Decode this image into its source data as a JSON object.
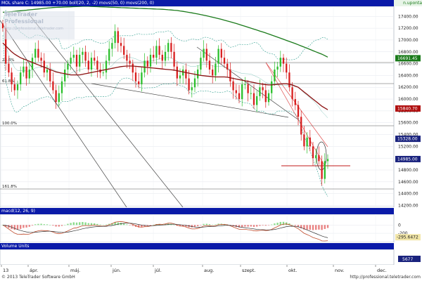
{
  "header": {
    "main": "MOL share C: 14985.00 +70.00 boll(20, 2, -2) movs(50, 0) movs(200, 0)",
    "main_right": "n.uponta",
    "macd": "macd(12, 26, 9)",
    "volume": "Volume Units"
  },
  "watermark": {
    "line1": "TeleTrader Professional",
    "line2": "http://professional.teletrader.com"
  },
  "footer": {
    "left": "© 2013 TeleTrader Software GmbH",
    "right": "http://professional.teletrader.com"
  },
  "fib_labels": [
    "23.6%",
    "61.8%",
    "100.0%",
    "161.8%"
  ],
  "colors": {
    "header_bg": "#0a1aa8",
    "up": "#2bbf2b",
    "down": "#d81e1e",
    "ma50": "#8b1010",
    "ma200": "#1a7a1a",
    "boll": "#2e9e8e",
    "marker_bg": "#1a237e"
  },
  "chart_data": {
    "type": "candlestick",
    "price_axis": {
      "ticks": [
        14200,
        14400,
        14600,
        14800,
        15000,
        15200,
        15400,
        15600,
        15800,
        16000,
        16200,
        16400,
        16600,
        16800,
        17000,
        17200,
        17400
      ],
      "ylim": [
        14170,
        17570
      ]
    },
    "markers": [
      {
        "label": "16691.45",
        "value": 16691.45
      },
      {
        "label": "15840.70",
        "value": 15840.7
      },
      {
        "label": "15328.00",
        "value": 15328.0
      },
      {
        "label": "14985.00",
        "value": 14985.0
      }
    ],
    "x_ticks": [
      "13",
      "ápr.",
      "máj.",
      "jún.",
      "júl.",
      "aug.",
      "szept.",
      "okt.",
      "nov.",
      "dec."
    ],
    "macd_axis": {
      "ticks": [
        0,
        -200
      ],
      "marker": "-295.6472"
    },
    "volume_marker": "5677",
    "close": [
      17200,
      16600,
      16450,
      16250,
      16150,
      16250,
      16450,
      16550,
      16350,
      16500,
      16700,
      16850,
      16700,
      16650,
      16450,
      16500,
      16300,
      16150,
      15950,
      16100,
      16300,
      16500,
      16600,
      16700,
      16750,
      16550,
      16750,
      16800,
      16650,
      16500,
      16700,
      16650,
      16500,
      16450,
      16450,
      16650,
      16850,
      16950,
      17150,
      16950,
      16900,
      16750,
      16650,
      16600,
      16450,
      16300,
      16250,
      16450,
      16650,
      16550,
      16750,
      16700,
      16900,
      16750,
      16650,
      16800,
      16950,
      16800,
      16550,
      16350,
      16400,
      16500,
      16350,
      16150,
      16200,
      16350,
      16500,
      16700,
      16850,
      16650,
      16500,
      16400,
      16600,
      16850,
      16700,
      16600,
      16500,
      16300,
      16150,
      16100,
      16000,
      16250,
      16250,
      16100,
      16100,
      15900,
      16050,
      16200,
      16150,
      15950,
      16100,
      16300,
      16500,
      16550,
      16700,
      16600,
      16450,
      16200,
      16000,
      15900,
      15700,
      15400,
      15200,
      15350,
      15200,
      15000,
      15050,
      14950,
      14650,
      14950,
      14985
    ],
    "ma50": [
      16950,
      16900,
      16850,
      16800,
      16760,
      16730,
      16700,
      16680,
      16660,
      16640,
      16620,
      16600,
      16580,
      16560,
      16540,
      16520,
      16500,
      16480,
      16460,
      16450,
      16440,
      16430,
      16420,
      16410,
      16410,
      16410,
      16410,
      16420,
      16430,
      16440,
      16450,
      16460,
      16470,
      16480,
      16490,
      16500,
      16510,
      16520,
      16530,
      16540,
      16550,
      16555,
      16560,
      16560,
      16560,
      16555,
      16550,
      16545,
      16540,
      16535,
      16530,
      16525,
      16520,
      16515,
      16510,
      16505,
      16500,
      16495,
      16490,
      16480,
      16470,
      16460,
      16450,
      16440,
      16430,
      16420,
      16410,
      16400,
      16395,
      16390,
      16385,
      16380,
      16375,
      16375,
      16375,
      16375,
      16370,
      16360,
      16350,
      16340,
      16330,
      16320,
      16310,
      16300,
      16290,
      16280,
      16270,
      16260,
      16250,
      16245,
      16240,
      16240,
      16245,
      16250,
      16255,
      16260,
      16260,
      16250,
      16240,
      16220,
      16200,
      16160,
      16120,
      16080,
      16040,
      16000,
      15960,
      15920,
      15880,
      15850,
      15820
    ],
    "ma200": [
      17470,
      17470,
      17475,
      17480,
      17485,
      17490,
      17495,
      17500,
      17505,
      17510,
      17515,
      17520,
      17525,
      17530,
      17535,
      17540,
      17545,
      17550,
      17552,
      17554,
      17556,
      17558,
      17560,
      17562,
      17564,
      17566,
      17568,
      17570,
      17570,
      17570,
      17568,
      17566,
      17564,
      17562,
      17560,
      17558,
      17556,
      17554,
      17552,
      17550,
      17548,
      17546,
      17544,
      17542,
      17540,
      17538,
      17536,
      17534,
      17532,
      17530,
      17528,
      17526,
      17524,
      17522,
      17520,
      17516,
      17512,
      17508,
      17504,
      17500,
      17492,
      17484,
      17476,
      17468,
      17460,
      17450,
      17440,
      17430,
      17420,
      17410,
      17398,
      17386,
      17374,
      17362,
      17350,
      17336,
      17322,
      17308,
      17294,
      17280,
      17264,
      17248,
      17232,
      17216,
      17200,
      17184,
      17168,
      17152,
      17136,
      17120,
      17102,
      17084,
      17066,
      17048,
      17030,
      17012,
      16994,
      16976,
      16958,
      16940,
      16920,
      16900,
      16880,
      16860,
      16840,
      16820,
      16800,
      16780,
      16760,
      16735,
      16710
    ]
  }
}
